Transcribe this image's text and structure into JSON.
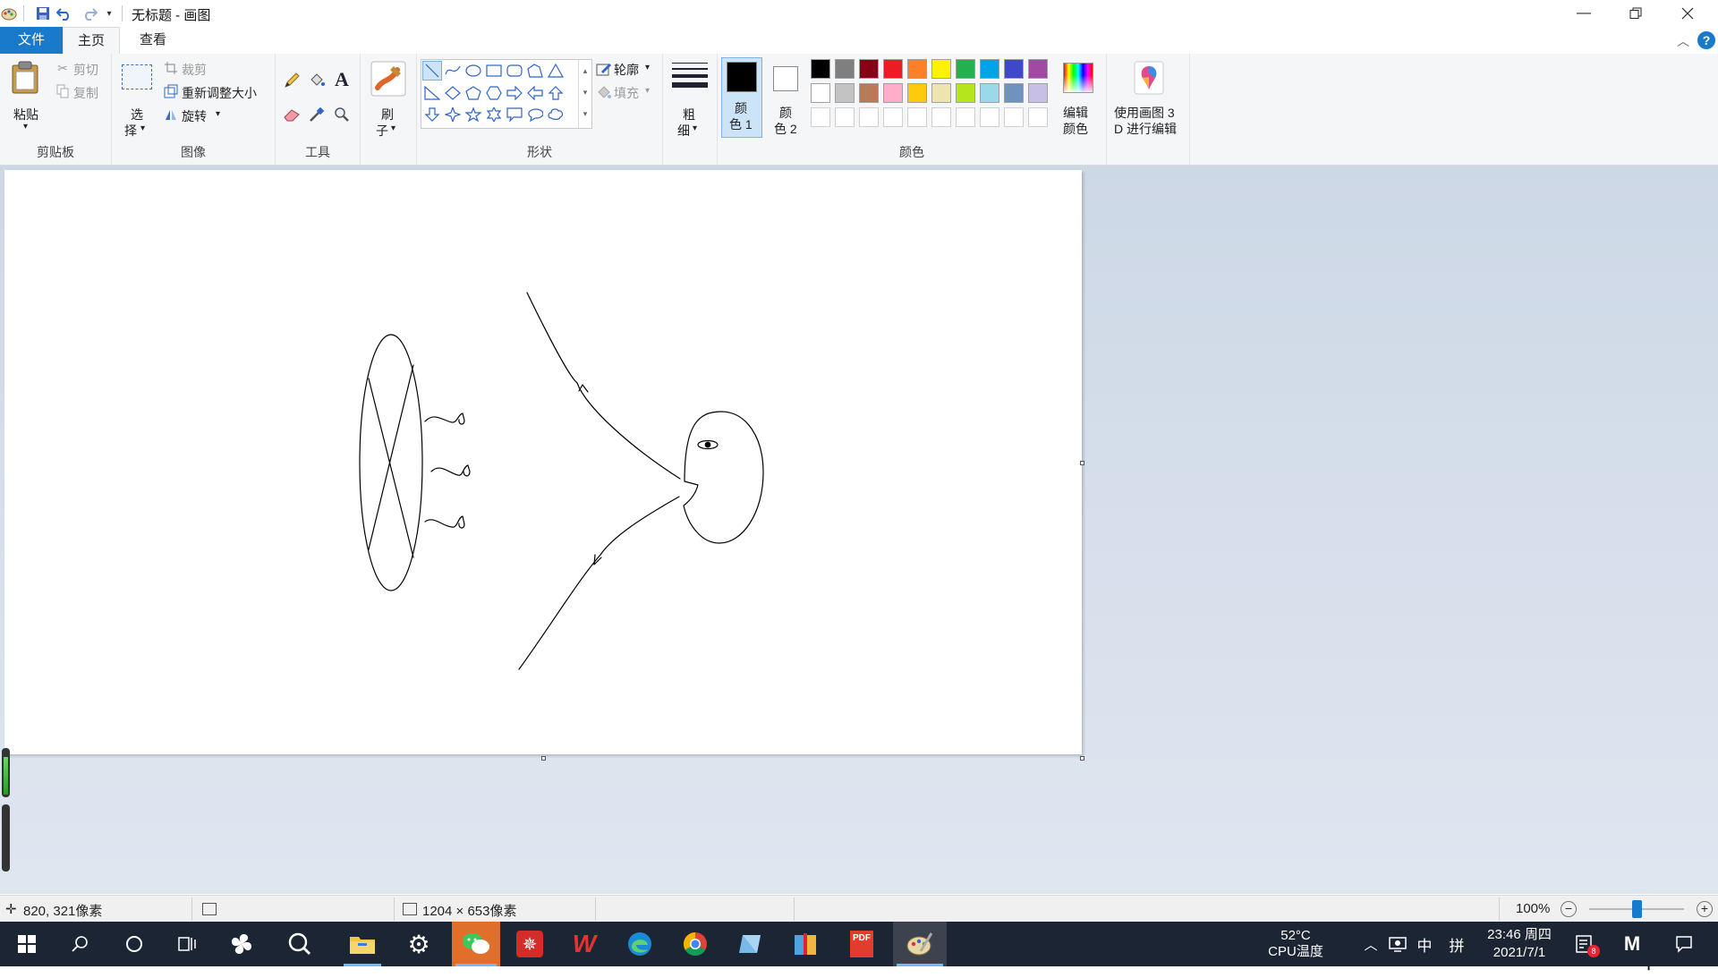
{
  "window": {
    "title": "无标题 - 画图",
    "minimize_icon": "minimize-icon",
    "restore_icon": "restore-icon",
    "close_icon": "close-icon"
  },
  "quick_access": {
    "items": [
      "app-icon",
      "save-icon",
      "undo-icon",
      "redo-icon",
      "customize-icon"
    ]
  },
  "tabs": [
    {
      "label": "文件",
      "active": false
    },
    {
      "label": "主页",
      "active": true
    },
    {
      "label": "查看",
      "active": false
    }
  ],
  "ribbon": {
    "clipboard": {
      "group_label": "剪贴板",
      "paste_label": "粘贴",
      "cut_label": "剪切",
      "copy_label": "复制"
    },
    "image": {
      "group_label": "图像",
      "select_label_1": "选",
      "select_label_2": "择",
      "crop_label": "裁剪",
      "resize_label": "重新调整大小",
      "rotate_label": "旋转"
    },
    "tools": {
      "group_label": "工具",
      "items": [
        "pencil-icon",
        "fill-icon",
        "text-icon",
        "eraser-icon",
        "color-picker-icon",
        "magnifier-icon"
      ]
    },
    "brushes": {
      "label_1": "刷",
      "label_2": "子"
    },
    "shapes": {
      "group_label": "形状",
      "outline_label": "轮廓",
      "fill_label": "填充"
    },
    "size": {
      "label_1": "粗",
      "label_2": "细"
    },
    "colors": {
      "group_label": "颜色",
      "color1_label_1": "颜",
      "color1_label_2": "色 1",
      "color2_label_1": "颜",
      "color2_label_2": "色 2",
      "color1_value": "#000000",
      "color2_value": "#ffffff",
      "palette_row1": [
        "#000000",
        "#7f7f7f",
        "#880015",
        "#ed1c24",
        "#ff7f27",
        "#fff200",
        "#22b14c",
        "#00a2e8",
        "#3f48cc",
        "#a349a4"
      ],
      "palette_row2": [
        "#ffffff",
        "#c3c3c3",
        "#b97a57",
        "#ffaec9",
        "#ffc90e",
        "#efe4b0",
        "#b5e61d",
        "#99d9ea",
        "#7092be",
        "#c8bfe7"
      ],
      "edit_colors_label_1": "编辑",
      "edit_colors_label_2": "颜色"
    },
    "paint3d": {
      "label_1": "使用画图 3",
      "label_2": "D 进行编辑"
    }
  },
  "ime": {
    "mode": "中"
  },
  "statusbar": {
    "cursor_pos": "820, 321像素",
    "canvas_size": "1204 × 653像素",
    "zoom": "100%",
    "zoom_level": 0.5
  },
  "taskbar": {
    "temp": "52°C",
    "temp_label": "CPU温度",
    "ime_mode": "中",
    "ime_layout": "拼",
    "time": "23:46 周四",
    "date": "2021/7/1",
    "notification_badge": "8"
  }
}
